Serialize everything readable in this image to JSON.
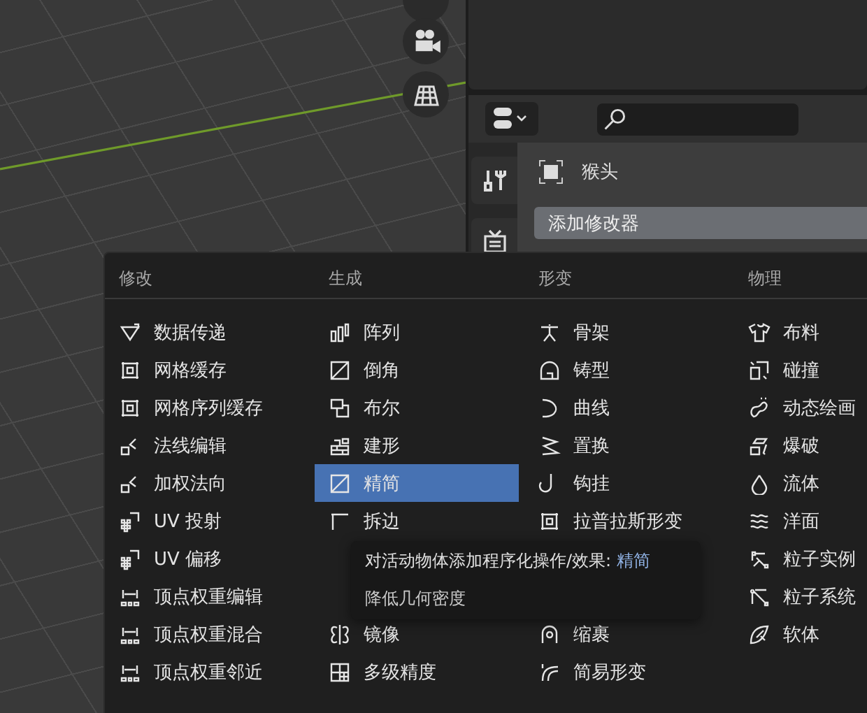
{
  "properties": {
    "object_name": "猴头",
    "add_modifier_button": "添加修改器"
  },
  "menu": {
    "columns": [
      {
        "header": "修改",
        "items": [
          {
            "kind": "item",
            "label": "数据传递",
            "selected": false
          },
          {
            "kind": "item",
            "label": "网格缓存",
            "selected": false
          },
          {
            "kind": "item",
            "label": "网格序列缓存",
            "selected": false
          },
          {
            "kind": "item",
            "label": "法线编辑",
            "selected": false
          },
          {
            "kind": "item",
            "label": "加权法向",
            "selected": false
          },
          {
            "kind": "item",
            "label": "UV 投射",
            "selected": false
          },
          {
            "kind": "item",
            "label": "UV 偏移",
            "selected": false
          },
          {
            "kind": "item",
            "label": "顶点权重编辑",
            "selected": false
          },
          {
            "kind": "item",
            "label": "顶点权重混合",
            "selected": false
          },
          {
            "kind": "item",
            "label": "顶点权重邻近",
            "selected": false
          }
        ]
      },
      {
        "header": "生成",
        "items": [
          {
            "kind": "item",
            "label": "阵列",
            "selected": false
          },
          {
            "kind": "item",
            "label": "倒角",
            "selected": false
          },
          {
            "kind": "item",
            "label": "布尔",
            "selected": false
          },
          {
            "kind": "item",
            "label": "建形",
            "selected": false
          },
          {
            "kind": "item",
            "label": "精简",
            "selected": true
          },
          {
            "kind": "item",
            "label": "拆边",
            "selected": false
          },
          {
            "kind": "covered"
          },
          {
            "kind": "covered"
          },
          {
            "kind": "item",
            "label": "镜像",
            "selected": false
          },
          {
            "kind": "item",
            "label": "多级精度",
            "selected": false
          }
        ]
      },
      {
        "header": "形变",
        "items": [
          {
            "kind": "item",
            "label": "骨架",
            "selected": false
          },
          {
            "kind": "item",
            "label": "铸型",
            "selected": false
          },
          {
            "kind": "item",
            "label": "曲线",
            "selected": false
          },
          {
            "kind": "item",
            "label": "置换",
            "selected": false
          },
          {
            "kind": "item",
            "label": "钩挂",
            "selected": false
          },
          {
            "kind": "item",
            "label": "拉普拉斯形变",
            "selected": false
          },
          {
            "kind": "covered"
          },
          {
            "kind": "covered"
          },
          {
            "kind": "item",
            "label": "缩裹",
            "selected": false
          },
          {
            "kind": "item",
            "label": "简易形变",
            "selected": false
          }
        ]
      },
      {
        "header": "物理",
        "items": [
          {
            "kind": "item",
            "label": "布料",
            "selected": false
          },
          {
            "kind": "item",
            "label": "碰撞",
            "selected": false
          },
          {
            "kind": "item",
            "label": "动态绘画",
            "selected": false
          },
          {
            "kind": "item",
            "label": "爆破",
            "selected": false
          },
          {
            "kind": "item",
            "label": "流体",
            "selected": false
          },
          {
            "kind": "item",
            "label": "洋面",
            "selected": false
          },
          {
            "kind": "item",
            "label": "粒子实例",
            "selected": false
          },
          {
            "kind": "item",
            "label": "粒子系统",
            "selected": false
          },
          {
            "kind": "item",
            "label": "软体",
            "selected": false
          }
        ]
      }
    ]
  },
  "tooltip": {
    "text": "对活动物体添加程序化操作/效果: ",
    "highlight": "精简",
    "description": "降低几何密度"
  }
}
